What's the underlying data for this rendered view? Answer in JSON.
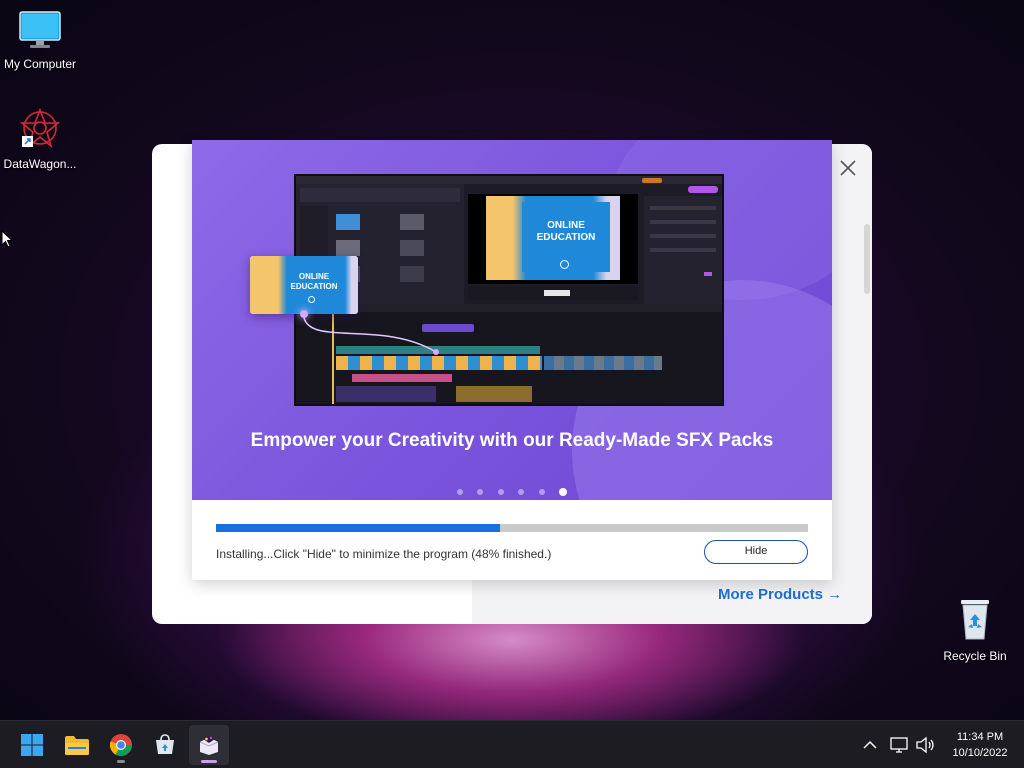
{
  "desktop": {
    "icons": [
      {
        "label": "My Computer"
      },
      {
        "label": "DataWagon..."
      },
      {
        "label": "Recycle Bin"
      }
    ]
  },
  "installer": {
    "slide": {
      "title": "Empower your Creativity with our Ready-Made SFX Packs",
      "preview_card_text": "ONLINE\nEDUCATION",
      "preview_main_text": "ONLINE\nEDUCATION",
      "total_slides": 6,
      "active_slide": 6
    },
    "progress": {
      "percent": 48,
      "status": "Installing...Click \"Hide\" to minimize the program (48% finished.)"
    },
    "hide_label": "Hide",
    "more_products_label": "More Products →"
  },
  "taskbar": {
    "apps": [
      "start-icon",
      "file-explorer-icon",
      "chrome-icon",
      "store-icon",
      "installer-app-icon"
    ],
    "clock": {
      "time": "11:34 PM",
      "date": "10/10/2022"
    }
  },
  "colors": {
    "accent": "#1670dd",
    "banner": "#7b55dc",
    "link": "#1f6bd0"
  }
}
